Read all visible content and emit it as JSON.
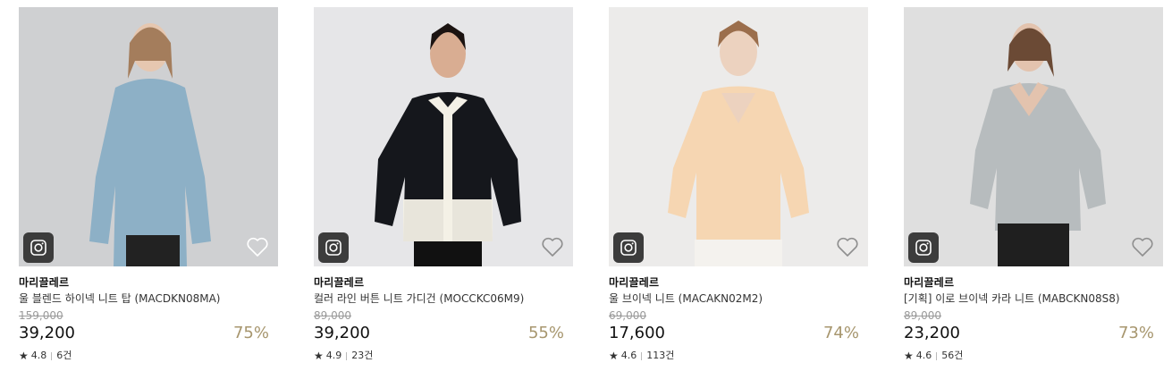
{
  "products": [
    {
      "brand": "마리끌레르",
      "name": "울 블렌드 하이넥 니트 탑 (MACDKN08MA)",
      "original_price": "159,000",
      "price": "39,200",
      "discount": "75%",
      "rating": "4.8",
      "reviews": "6건",
      "bg_color": "#cfd0d2",
      "garment_color": "#8db0c6",
      "image_icon": "instagram-icon",
      "wish_icon": "heart-outline-icon"
    },
    {
      "brand": "마리끌레르",
      "name": "컬러 라인 버튼 니트 가디건 (MOCCKC06M9)",
      "original_price": "89,000",
      "price": "39,200",
      "discount": "55%",
      "rating": "4.9",
      "reviews": "23건",
      "bg_color": "#e6e6e8",
      "garment_color": "#15171c",
      "image_icon": "instagram-icon",
      "wish_icon": "heart-outline-icon"
    },
    {
      "brand": "마리끌레르",
      "name": "울 브이넥 니트 (MACAKN02M2)",
      "original_price": "69,000",
      "price": "17,600",
      "discount": "74%",
      "rating": "4.6",
      "reviews": "113건",
      "bg_color": "#ecebea",
      "garment_color": "#f6d6b2",
      "image_icon": "instagram-icon",
      "wish_icon": "heart-outline-icon"
    },
    {
      "brand": "마리끌레르",
      "name": "[기획] 이로 브이넥 카라 니트 (MABCKN08S8)",
      "original_price": "89,000",
      "price": "23,200",
      "discount": "73%",
      "rating": "4.6",
      "reviews": "56건",
      "bg_color": "#dfdfdf",
      "garment_color": "#b7bcbe",
      "image_icon": "instagram-icon",
      "wish_icon": "heart-outline-icon"
    }
  ],
  "colors": {
    "discount": "#a7966e",
    "original_price": "#9a9a9a",
    "insta_button": "#3c3c3c"
  }
}
